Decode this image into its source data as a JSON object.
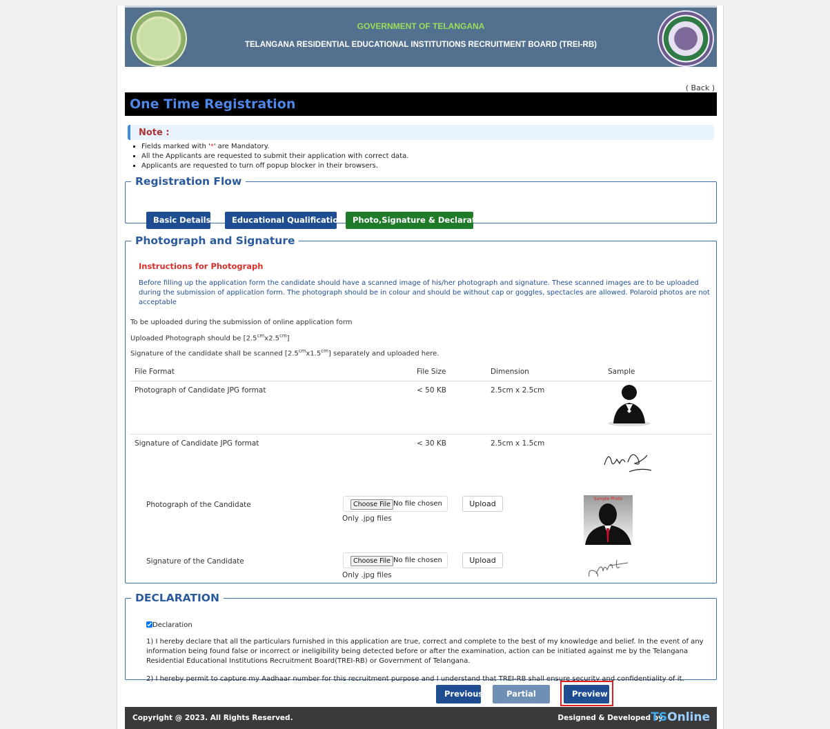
{
  "header": {
    "government": "GOVERNMENT OF TELANGANA",
    "board": "TELANGANA RESIDENTIAL EDUCATIONAL INSTITUTIONS RECRUITMENT BOARD (TREI-RB)",
    "left_emblem_icon": "telangana-government-seal",
    "right_emblem_icon": "treirb-logo"
  },
  "back_link": "( Back )",
  "page_title": "One Time Registration",
  "note": {
    "title": "Note :",
    "items": [
      "are Mandatory.",
      "All the Applicants are requested to submit their application with correct data.",
      "Applicants are requested to turn off popup blocker in their browsers."
    ],
    "item0_prefix": "Fields marked with '",
    "item0_star": "*",
    "item0_suffix": "' "
  },
  "registration_flow": {
    "legend": "Registration Flow",
    "steps": [
      "Basic Details",
      "Educational Qualifications",
      "Photo,Signature & Declaration"
    ]
  },
  "photo_section": {
    "legend": "Photograph and Signature",
    "instructions_title": "Instructions for Photograph",
    "instructions": "Before filling up the application form the candidate should have a scanned image of his/her photograph and signature. These scanned images are to be uploaded during the submission of application form. The photograph should be in colour and should be without cap or goggles, spectacles are allowed. Polaroid photos are not acceptable",
    "line1": "To be uploaded during the submission of online application form",
    "line2_prefix": "Uploaded Photograph should be [2.5",
    "line2_sup1": "cm",
    "line2_mid": "x2.5",
    "line2_sup2": "cm",
    "line2_suffix": "]",
    "line3_prefix": "Signature of the candidate shall be scanned [2.5",
    "line3_sup1": "cm",
    "line3_mid": "x1.5",
    "line3_sup2": "cm",
    "line3_suffix": "] separately and uploaded here.",
    "table_headers": [
      "File Format",
      "File Size",
      "Dimension",
      "Sample"
    ],
    "rows": [
      {
        "format": "Photograph of Candidate JPG format",
        "size": "< 50 KB",
        "dimension": "2.5cm x 2.5cm"
      },
      {
        "format": "Signature of Candidate JPG format",
        "size": "< 30 KB",
        "dimension": "2.5cm x 1.5cm"
      }
    ],
    "uploads": [
      {
        "label": "Photograph of the Candidate",
        "choose": "Choose File",
        "status": "No file chosen",
        "hint": "Only .jpg files",
        "button": "Upload",
        "sample_label": "Sample Photo"
      },
      {
        "label": "Signature of the Candidate",
        "choose": "Choose File",
        "status": "No file chosen",
        "hint": "Only .jpg files",
        "button": "Upload"
      }
    ]
  },
  "declaration": {
    "legend": "DECLARATION",
    "checkbox_label": "Declaration",
    "checked": true,
    "para1": "1) I hereby declare that all the particulars furnished in this application are true, correct and complete to the best of my knowledge and belief. In the event of any information being found false or incorrect or ineligibility being detected before or after the examination, action can be initiated against me by the Telangana Residential Educational Institutions Recruitment Board(TREI-RB) or Government of Telangana.",
    "para2": "2) I hereby permit to capture my Aadhaar number for this recruitment purpose and I understand that TREI-RB shall ensure security and confidentiality of it."
  },
  "actions": {
    "previous": "Previous",
    "partial_save": "Partial Save",
    "preview": "Preview"
  },
  "footer": {
    "copyright": "Copyright @ 2023. All Rights Reserved.",
    "designed_by": "Designed & Developed by",
    "logo_ts": "TS",
    "logo_online": "Online"
  },
  "colors": {
    "header_bg": "#53708f",
    "primary": "#1f4d92",
    "active_step": "#1f7a2a",
    "highlight": "#e02020"
  }
}
